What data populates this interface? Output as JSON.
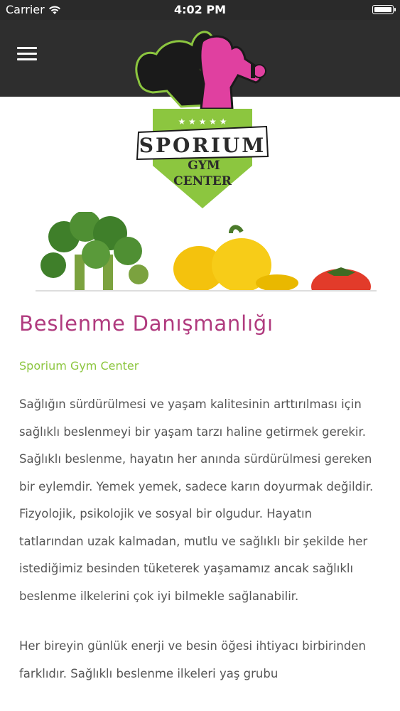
{
  "status_bar": {
    "carrier": "Carrier",
    "time": "4:02 PM"
  },
  "header": {
    "menu_icon": "hamburger-menu-icon",
    "background": "#2e2e2e"
  },
  "logo": {
    "name": "SPORIUM",
    "sub1": "GYM",
    "sub2": "CENTER",
    "stars": "★ ★ ★ ★ ★",
    "accent_green": "#8cc63f",
    "accent_pink": "#e040a0"
  },
  "article": {
    "title": "Beslenme Danışmanlığı",
    "subtitle": "Sporium Gym Center",
    "paragraph_1": "Sağlığın sürdürülmesi ve yaşam kalitesinin arttırılması için sağlıklı beslenmeyi bir yaşam tarzı haline getirmek gerekir. Sağlıklı beslenme, hayatın her anında sürdürülmesi gereken bir eylemdir. Yemek yemek, sadece karın doyurmak değildir. Fizyolojik, psikolojik ve sosyal bir olgudur. Hayatın tatlarından uzak kalmadan, mutlu ve sağlıklı bir şekilde her istediğimiz besinden tüketerek yaşamamız ancak sağlıklı beslenme ilkelerini çok iyi bilmekle sağlanabilir.",
    "paragraph_2": "Her bireyin günlük enerji ve besin öğesi ihtiyacı birbirinden farklıdır. Sağlıklı beslenme ilkeleri yaş grubu"
  }
}
